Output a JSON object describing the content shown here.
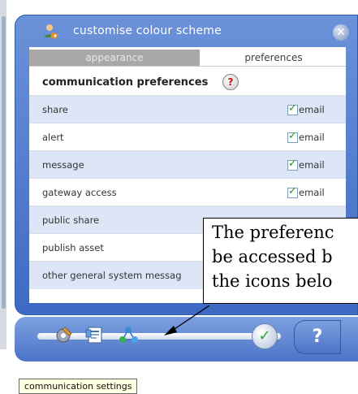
{
  "dialog": {
    "title": "customise colour scheme",
    "close_symbol": "✕"
  },
  "tabs": [
    {
      "label": "appearance",
      "active": false
    },
    {
      "label": "preferences",
      "active": true
    }
  ],
  "section": {
    "title": "communication preferences",
    "help_symbol": "?"
  },
  "rows": [
    {
      "label": "share",
      "option": "email",
      "checked": true
    },
    {
      "label": "alert",
      "option": "email",
      "checked": true
    },
    {
      "label": "message",
      "option": "email",
      "checked": true
    },
    {
      "label": "gateway access",
      "option": "email",
      "checked": true
    },
    {
      "label": "public share",
      "option": "",
      "checked": false
    },
    {
      "label": "publish asset",
      "option": "",
      "checked": false
    },
    {
      "label": "other general system messag",
      "option": "",
      "checked": false
    }
  ],
  "toolbar": {
    "icons": [
      "settings-tool-icon",
      "document-icon",
      "communication-settings-icon"
    ],
    "ok_symbol": "✓",
    "help_label": "?"
  },
  "tooltip": "communication settings",
  "callout": {
    "lines": [
      "The preferenc",
      "be accessed b",
      "the icons belo"
    ]
  },
  "colors": {
    "accent": "#4b73c7",
    "row_alt": "#dde6f7",
    "check": "#1a9a1a"
  }
}
